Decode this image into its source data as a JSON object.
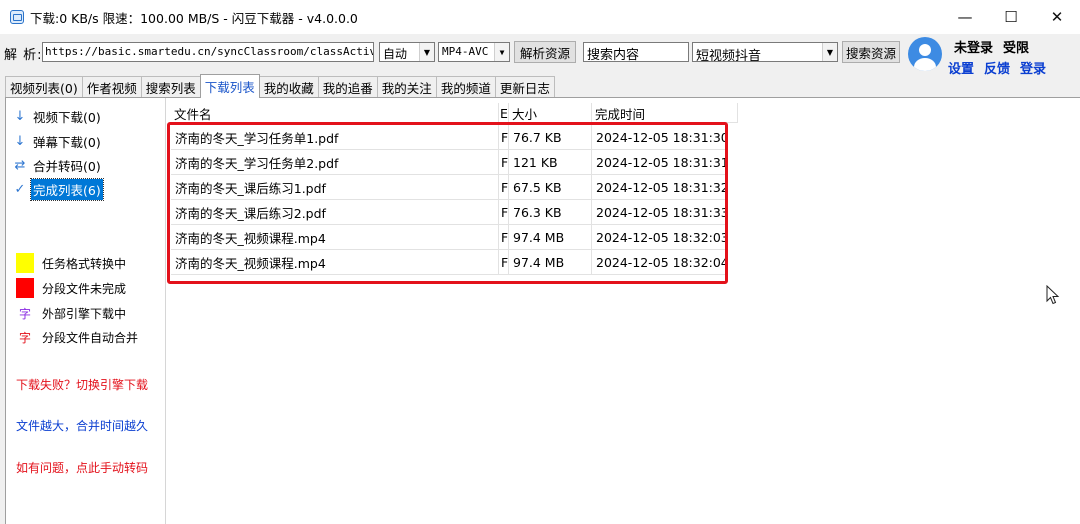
{
  "titlebar": {
    "title": "下载:0 KB/s  限速：100.00 MB/S  - 闪豆下载器 - v4.0.0.0",
    "minimize": "—",
    "maximize": "☐",
    "close": "✕"
  },
  "toolbar": {
    "parse_label": "解 析:",
    "url_value": "https://basic.smartedu.cn/syncClassroom/classActivity",
    "quality_value": "自动",
    "format_value": "MP4-AVC",
    "parse_button": "解析资源",
    "search_placeholder": "搜索内容",
    "platform_value": "短视频抖音",
    "search_button": "搜索资源"
  },
  "user": {
    "status": "未登录",
    "limit": "受限",
    "settings": "设置",
    "feedback": "反馈",
    "login": "登录"
  },
  "tabs": [
    {
      "label": "视频列表(0)"
    },
    {
      "label": "作者视频"
    },
    {
      "label": "搜索列表"
    },
    {
      "label": "下载列表"
    },
    {
      "label": "我的收藏"
    },
    {
      "label": "我的追番"
    },
    {
      "label": "我的关注"
    },
    {
      "label": "我的频道"
    },
    {
      "label": "更新日志"
    }
  ],
  "tree": [
    {
      "icon": "↓",
      "label": "视频下载(0)"
    },
    {
      "icon": "↓",
      "label": "弹幕下载(0)"
    },
    {
      "icon": "⇄",
      "label": "合并转码(0)"
    },
    {
      "icon": "✓",
      "label": "完成列表(6)"
    }
  ],
  "legend": [
    {
      "label": "任务格式转换中",
      "color": "#ffff00"
    },
    {
      "label": "分段文件未完成",
      "color": "#ff0000"
    },
    {
      "label": "外部引擎下载中",
      "glyph": "字",
      "color": "#8a2be2"
    },
    {
      "label": "分段文件自动合并",
      "glyph": "字",
      "color": "#e3111b"
    }
  ],
  "notes": [
    {
      "text": "下载失败？切换引擎下载",
      "color": "#e3111b"
    },
    {
      "text": "文件越大，合并时间越久",
      "color": "#0b3fd1"
    },
    {
      "text": "如有问题，点此手动转码",
      "color": "#e3111b"
    }
  ],
  "list": {
    "headers": [
      "文件名",
      "E",
      "大小",
      "完成时间"
    ],
    "rows": [
      {
        "name": "济南的冬天_学习任务单1.pdf",
        "flag": "F",
        "size": "76.7 KB",
        "time": "2024-12-05 18:31:30"
      },
      {
        "name": "济南的冬天_学习任务单2.pdf",
        "flag": "F",
        "size": "121 KB",
        "time": "2024-12-05 18:31:31"
      },
      {
        "name": "济南的冬天_课后练习1.pdf",
        "flag": "F",
        "size": "67.5 KB",
        "time": "2024-12-05 18:31:32"
      },
      {
        "name": "济南的冬天_课后练习2.pdf",
        "flag": "F",
        "size": "76.3 KB",
        "time": "2024-12-05 18:31:33"
      },
      {
        "name": "济南的冬天_视频课程.mp4",
        "flag": "F",
        "size": "97.4 MB",
        "time": "2024-12-05 18:32:03"
      },
      {
        "name": "济南的冬天_视频课程.mp4",
        "flag": "F",
        "size": "97.4 MB",
        "time": "2024-12-05 18:32:04"
      }
    ]
  },
  "colors": {
    "accent": "#0078d7",
    "link": "#0b3fd1",
    "highlight": "#e3111b"
  }
}
